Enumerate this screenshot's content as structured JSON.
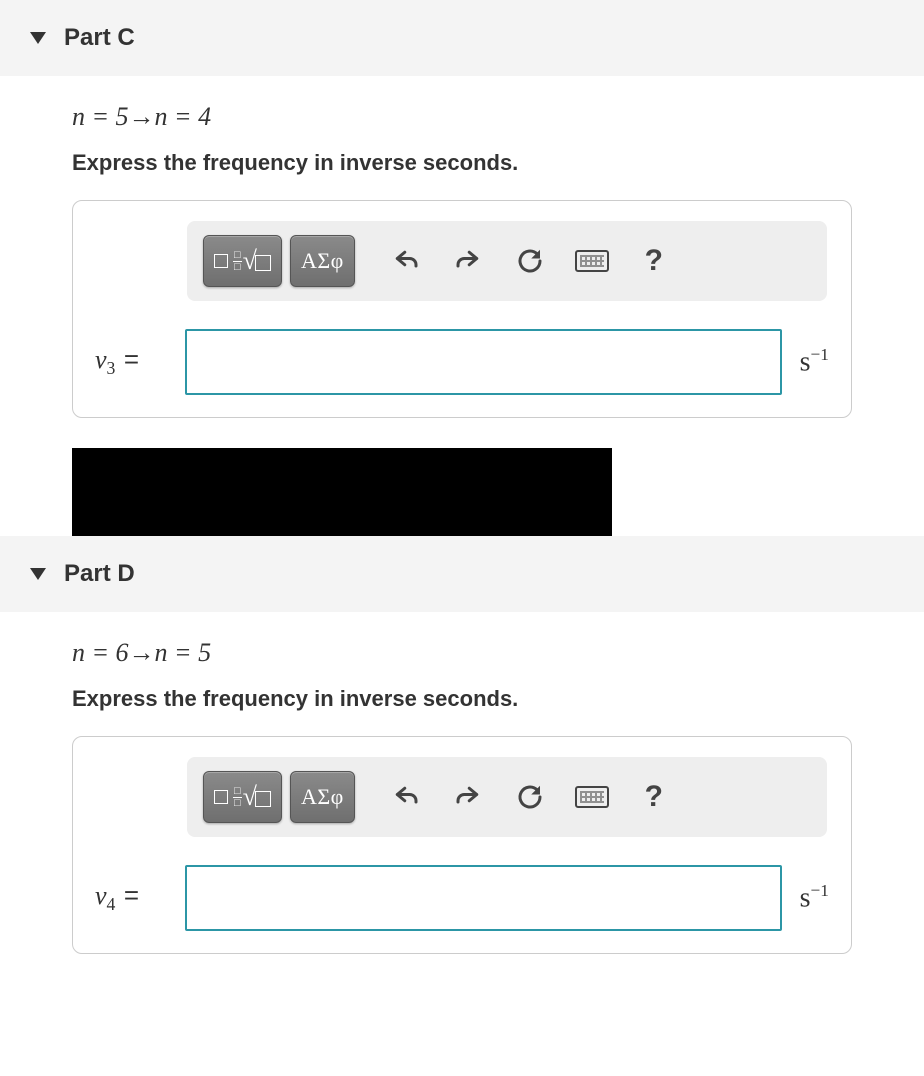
{
  "parts": {
    "c": {
      "title": "Part C",
      "formula": "n = 5→n = 4",
      "instruction": "Express the frequency in inverse seconds.",
      "variable_html": "ν<span class='sub'>3</span> <span class='equals'>=</span>",
      "variable_plain": "ν3 =",
      "unit_html": "s<span class='sup'>−1</span>",
      "unit_plain": "s−1",
      "value": ""
    },
    "d": {
      "title": "Part D",
      "formula": "n = 6→n = 5",
      "instruction": "Express the frequency in inverse seconds.",
      "variable_html": "ν<span class='sub'>4</span> <span class='equals'>=</span>",
      "variable_plain": "ν4 =",
      "unit_html": "s<span class='sup'>−1</span>",
      "unit_plain": "s−1",
      "value": ""
    }
  },
  "toolbar": {
    "templates_label": "templates",
    "greek_label": "ΑΣφ",
    "icons": {
      "undo": "undo-icon",
      "redo": "redo-icon",
      "reset": "reset-icon",
      "keyboard": "keyboard-icon",
      "help": "?"
    }
  }
}
